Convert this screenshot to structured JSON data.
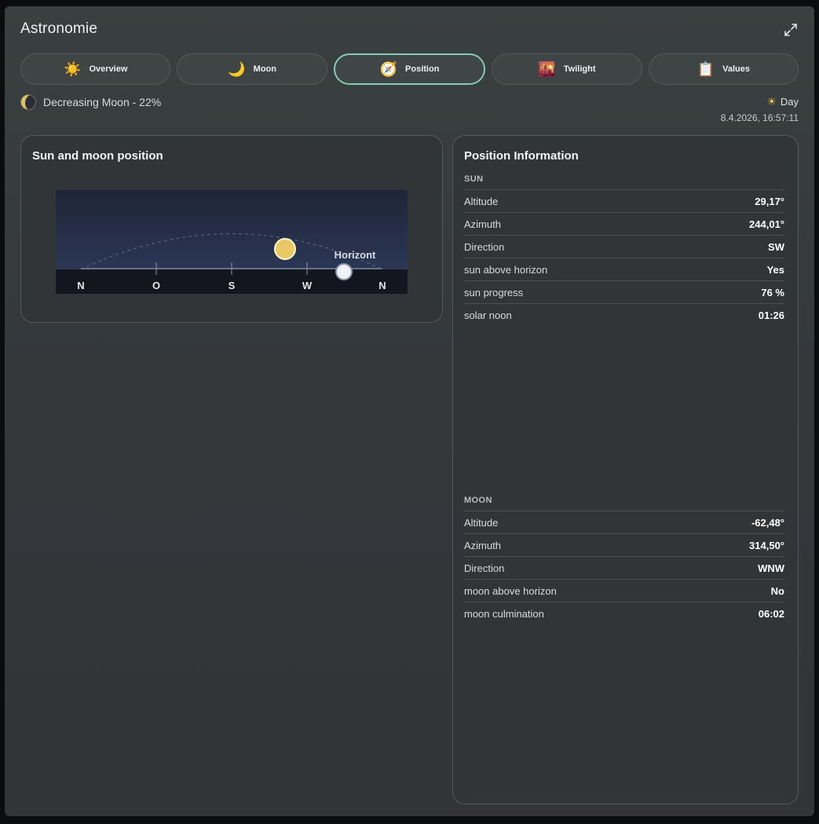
{
  "header": {
    "title": "Astronomie"
  },
  "tabs": [
    {
      "label": "Overview",
      "icon": "sun-icon"
    },
    {
      "label": "Moon",
      "icon": "crescent-moon-icon"
    },
    {
      "label": "Position",
      "icon": "compass-icon",
      "active": true
    },
    {
      "label": "Twilight",
      "icon": "twilight-icon"
    },
    {
      "label": "Values",
      "icon": "clipboard-icon"
    }
  ],
  "status": {
    "moon_phase": "Decreasing Moon - 22%",
    "day_state": "Day",
    "datetime": "8.4.2026, 16:57:11"
  },
  "left_panel": {
    "title": "Sun and moon position",
    "horizon_label": "Horizont",
    "compass": [
      "N",
      "O",
      "S",
      "W",
      "N"
    ]
  },
  "right_panel": {
    "title": "Position Information",
    "sun": {
      "label": "SUN",
      "rows": [
        {
          "key": "Altitude",
          "value": "29,17°"
        },
        {
          "key": "Azimuth",
          "value": "244,01°"
        },
        {
          "key": "Direction",
          "value": "SW"
        },
        {
          "key": "sun above horizon",
          "value": "Yes"
        },
        {
          "key": "sun progress",
          "value": "76 %"
        },
        {
          "key": "solar noon",
          "value": "01:26"
        }
      ]
    },
    "moon": {
      "label": "MOON",
      "rows": [
        {
          "key": "Altitude",
          "value": "-62,48°"
        },
        {
          "key": "Azimuth",
          "value": "314,50°"
        },
        {
          "key": "Direction",
          "value": "WNW"
        },
        {
          "key": "moon above horizon",
          "value": "No"
        },
        {
          "key": "moon culmination",
          "value": "06:02"
        }
      ]
    }
  },
  "colors": {
    "accent": "#86c9b5",
    "sun": "#eac864",
    "moon": "#eef1f8",
    "sky_top": "#1f2538",
    "sky_bottom": "#2b3755"
  }
}
